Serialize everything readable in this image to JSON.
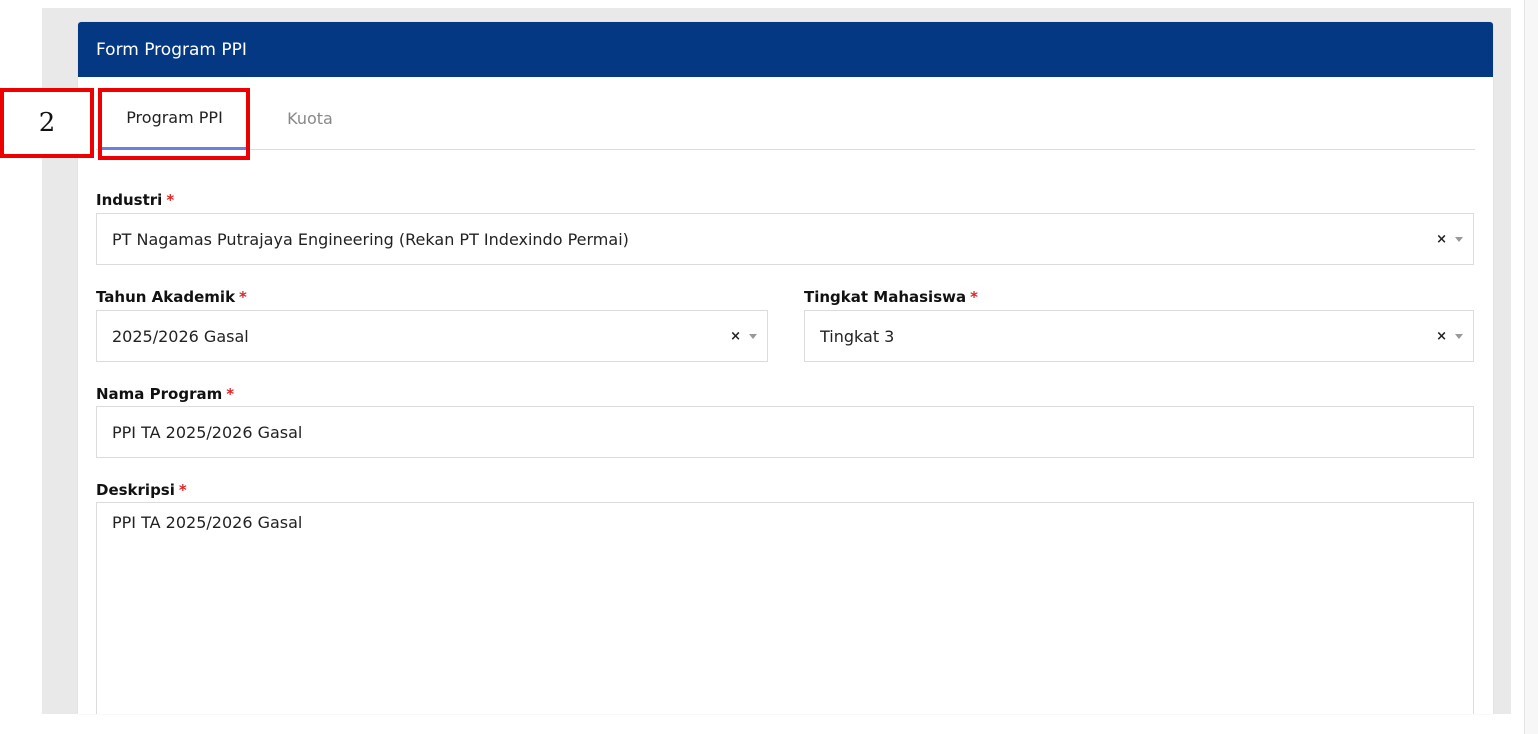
{
  "form": {
    "title": "Form Program PPI",
    "tabs": [
      {
        "label": "Program PPI",
        "active": true
      },
      {
        "label": "Kuota",
        "active": false
      }
    ],
    "fields": {
      "industri": {
        "label": "Industri",
        "required_mark": "*",
        "value": "PT Nagamas Putrajaya Engineering (Rekan PT Indexindo Permai)",
        "clear": "×"
      },
      "tahun_akademik": {
        "label": "Tahun Akademik",
        "required_mark": "*",
        "value": "2025/2026 Gasal",
        "clear": "×"
      },
      "tingkat_mahasiswa": {
        "label": "Tingkat Mahasiswa",
        "required_mark": "*",
        "value": "Tingkat 3",
        "clear": "×"
      },
      "nama_program": {
        "label": "Nama Program",
        "required_mark": "*",
        "value": "PPI TA 2025/2026 Gasal"
      },
      "deskripsi": {
        "label": "Deskripsi",
        "required_mark": "*",
        "value": "PPI TA 2025/2026 Gasal"
      }
    }
  },
  "annotation": {
    "number": "2",
    "color": "#ee0000"
  },
  "colors": {
    "header": "#053882",
    "tab_underline": "#6c7fe0",
    "required": "#e02424"
  }
}
